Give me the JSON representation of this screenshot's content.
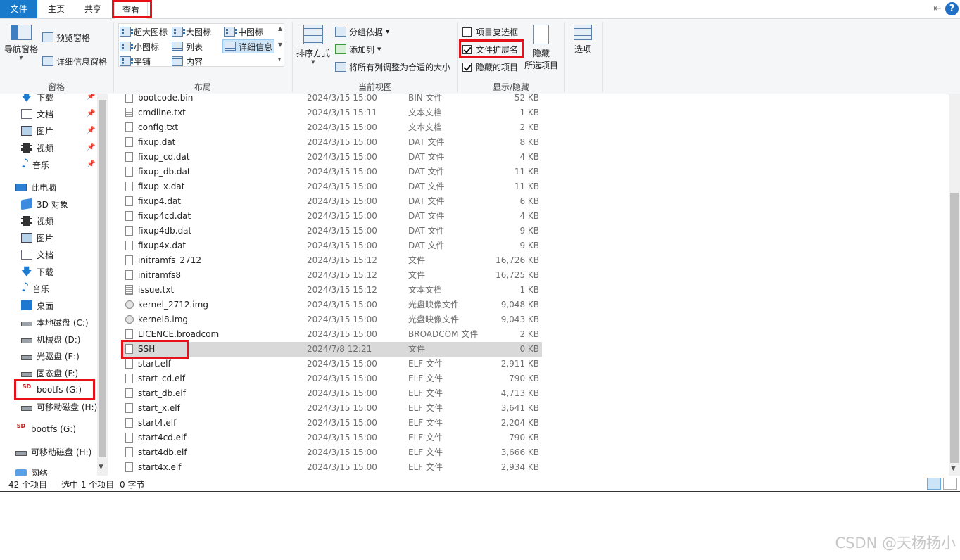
{
  "tabs": [
    "文件",
    "主页",
    "共享",
    "查看"
  ],
  "ribbon": {
    "pane_group": {
      "label": "窗格",
      "nav_pane": "导航窗格",
      "preview_pane": "预览窗格",
      "details_pane": "详细信息窗格"
    },
    "layout_group": {
      "label": "布局",
      "items": [
        "超大图标",
        "大图标",
        "中图标",
        "小图标",
        "列表",
        "详细信息",
        "平铺",
        "内容"
      ]
    },
    "view_group": {
      "label": "当前视图",
      "sort_by": "排序方式",
      "group_by": "分组依据",
      "add_column": "添加列",
      "fit_columns": "将所有列调整为合适的大小"
    },
    "show_group": {
      "label": "显示/隐藏",
      "item_checkboxes": "项目复选框",
      "file_extensions": "文件扩展名",
      "hidden_items": "隐藏的项目",
      "hide_selected": "隐藏",
      "hide_selected_2": "所选项目",
      "item_checkboxes_checked": false,
      "file_extensions_checked": true,
      "hidden_items_checked": true
    },
    "options": "选项"
  },
  "nav": [
    {
      "label": "下载",
      "icon": "download-icon"
    },
    {
      "label": "文档",
      "icon": "document-icon"
    },
    {
      "label": "图片",
      "icon": "picture-icon"
    },
    {
      "label": "视频",
      "icon": "video-icon"
    },
    {
      "label": "音乐",
      "icon": "music-icon"
    },
    {
      "label": "此电脑",
      "icon": "computer-icon"
    },
    {
      "label": "3D 对象",
      "icon": "3d-objects-icon"
    },
    {
      "label": "视频",
      "icon": "video-icon"
    },
    {
      "label": "图片",
      "icon": "picture-icon"
    },
    {
      "label": "文档",
      "icon": "document-icon"
    },
    {
      "label": "下载",
      "icon": "download-icon"
    },
    {
      "label": "音乐",
      "icon": "music-icon"
    },
    {
      "label": "桌面",
      "icon": "desktop-icon"
    },
    {
      "label": "本地磁盘 (C:)",
      "icon": "drive-icon"
    },
    {
      "label": "机械盘 (D:)",
      "icon": "drive-icon"
    },
    {
      "label": "光驱盘 (E:)",
      "icon": "drive-icon"
    },
    {
      "label": "固态盘 (F:)",
      "icon": "drive-icon"
    },
    {
      "label": "bootfs (G:)",
      "icon": "sd-card-icon"
    },
    {
      "label": "可移动磁盘 (H:)",
      "icon": "drive-icon"
    },
    {
      "label": "bootfs (G:)",
      "icon": "sd-card-icon"
    },
    {
      "label": "可移动磁盘 (H:)",
      "icon": "drive-icon"
    },
    {
      "label": "网络",
      "icon": "network-icon"
    }
  ],
  "files": [
    {
      "name": "bootcode.bin",
      "date": "2024/3/15 15:00",
      "type": "BIN 文件",
      "size": "52 KB"
    },
    {
      "name": "cmdline.txt",
      "date": "2024/3/15 15:11",
      "type": "文本文档",
      "size": "1 KB"
    },
    {
      "name": "config.txt",
      "date": "2024/3/15 15:00",
      "type": "文本文档",
      "size": "2 KB"
    },
    {
      "name": "fixup.dat",
      "date": "2024/3/15 15:00",
      "type": "DAT 文件",
      "size": "8 KB"
    },
    {
      "name": "fixup_cd.dat",
      "date": "2024/3/15 15:00",
      "type": "DAT 文件",
      "size": "4 KB"
    },
    {
      "name": "fixup_db.dat",
      "date": "2024/3/15 15:00",
      "type": "DAT 文件",
      "size": "11 KB"
    },
    {
      "name": "fixup_x.dat",
      "date": "2024/3/15 15:00",
      "type": "DAT 文件",
      "size": "11 KB"
    },
    {
      "name": "fixup4.dat",
      "date": "2024/3/15 15:00",
      "type": "DAT 文件",
      "size": "6 KB"
    },
    {
      "name": "fixup4cd.dat",
      "date": "2024/3/15 15:00",
      "type": "DAT 文件",
      "size": "4 KB"
    },
    {
      "name": "fixup4db.dat",
      "date": "2024/3/15 15:00",
      "type": "DAT 文件",
      "size": "9 KB"
    },
    {
      "name": "fixup4x.dat",
      "date": "2024/3/15 15:00",
      "type": "DAT 文件",
      "size": "9 KB"
    },
    {
      "name": "initramfs_2712",
      "date": "2024/3/15 15:12",
      "type": "文件",
      "size": "16,726 KB"
    },
    {
      "name": "initramfs8",
      "date": "2024/3/15 15:12",
      "type": "文件",
      "size": "16,725 KB"
    },
    {
      "name": "issue.txt",
      "date": "2024/3/15 15:12",
      "type": "文本文档",
      "size": "1 KB"
    },
    {
      "name": "kernel_2712.img",
      "date": "2024/3/15 15:00",
      "type": "光盘映像文件",
      "size": "9,048 KB"
    },
    {
      "name": "kernel8.img",
      "date": "2024/3/15 15:00",
      "type": "光盘映像文件",
      "size": "9,043 KB"
    },
    {
      "name": "LICENCE.broadcom",
      "date": "2024/3/15 15:00",
      "type": "BROADCOM 文件",
      "size": "2 KB"
    },
    {
      "name": "SSH",
      "date": "2024/7/8 12:21",
      "type": "文件",
      "size": "0 KB"
    },
    {
      "name": "start.elf",
      "date": "2024/3/15 15:00",
      "type": "ELF 文件",
      "size": "2,911 KB"
    },
    {
      "name": "start_cd.elf",
      "date": "2024/3/15 15:00",
      "type": "ELF 文件",
      "size": "790 KB"
    },
    {
      "name": "start_db.elf",
      "date": "2024/3/15 15:00",
      "type": "ELF 文件",
      "size": "4,713 KB"
    },
    {
      "name": "start_x.elf",
      "date": "2024/3/15 15:00",
      "type": "ELF 文件",
      "size": "3,641 KB"
    },
    {
      "name": "start4.elf",
      "date": "2024/3/15 15:00",
      "type": "ELF 文件",
      "size": "2,204 KB"
    },
    {
      "name": "start4cd.elf",
      "date": "2024/3/15 15:00",
      "type": "ELF 文件",
      "size": "790 KB"
    },
    {
      "name": "start4db.elf",
      "date": "2024/3/15 15:00",
      "type": "ELF 文件",
      "size": "3,666 KB"
    },
    {
      "name": "start4x.elf",
      "date": "2024/3/15 15:00",
      "type": "ELF 文件",
      "size": "2,934 KB"
    }
  ],
  "selected_file": "SSH",
  "status": {
    "count": "42 个项目",
    "selection": "选中 1 个项目",
    "size": "0 字节"
  },
  "watermark": "CSDN @天杨扬小",
  "colors": {
    "accent": "#1979ca",
    "highlight_box": "#e8111a",
    "selected_row": "#d9d9d9"
  }
}
